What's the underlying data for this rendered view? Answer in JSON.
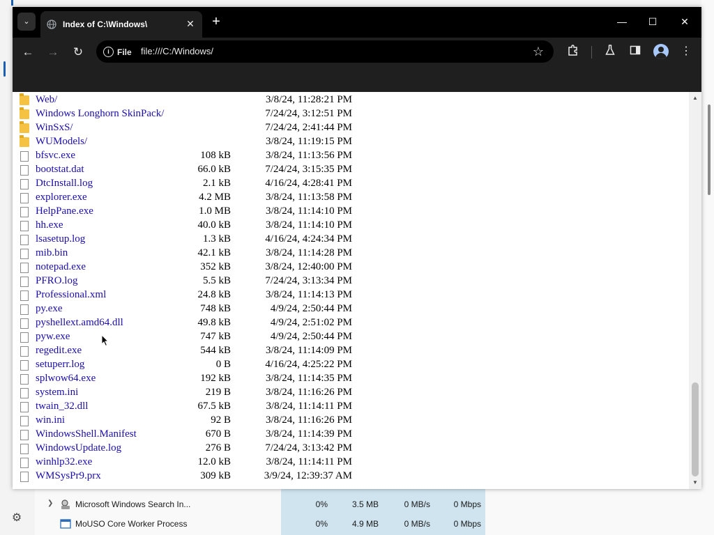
{
  "window": {
    "tab_title": "Index of C:\\Windows\\",
    "url": "file:///C:/Windows/",
    "url_chip_label": "File",
    "theme": {
      "frame": "#000000",
      "toolbar": "#1f1f1f",
      "link": "#1a0dab",
      "folder": "#f5c242"
    }
  },
  "icons": {
    "tab_search": "chevron-down-icon",
    "tab_favicon": "globe-icon",
    "tab_close": "close-icon",
    "new_tab": "plus-icon",
    "minimize": "minimize-icon",
    "maximize": "maximize-icon",
    "close_window": "close-icon",
    "back": "back-arrow-icon",
    "forward": "forward-arrow-icon",
    "reload": "reload-icon",
    "site_info": "info-icon",
    "bookmark": "star-icon",
    "extensions": "puzzle-icon",
    "labs": "flask-icon",
    "side_panel": "side-panel-icon",
    "profile": "avatar-icon",
    "menu": "kebab-menu-icon"
  },
  "listing": [
    {
      "name": "Web/",
      "size": "",
      "date": "3/8/24, 11:28:21 PM",
      "type": "folder"
    },
    {
      "name": "Windows Longhorn SkinPack/",
      "size": "",
      "date": "7/24/24, 3:12:51 PM",
      "type": "folder"
    },
    {
      "name": "WinSxS/",
      "size": "",
      "date": "7/24/24, 2:41:44 PM",
      "type": "folder"
    },
    {
      "name": "WUModels/",
      "size": "",
      "date": "3/8/24, 11:19:15 PM",
      "type": "folder"
    },
    {
      "name": "bfsvc.exe",
      "size": "108 kB",
      "date": "3/8/24, 11:13:56 PM",
      "type": "file"
    },
    {
      "name": "bootstat.dat",
      "size": "66.0 kB",
      "date": "7/24/24, 3:15:35 PM",
      "type": "file"
    },
    {
      "name": "DtcInstall.log",
      "size": "2.1 kB",
      "date": "4/16/24, 4:28:41 PM",
      "type": "file"
    },
    {
      "name": "explorer.exe",
      "size": "4.2 MB",
      "date": "3/8/24, 11:13:58 PM",
      "type": "file"
    },
    {
      "name": "HelpPane.exe",
      "size": "1.0 MB",
      "date": "3/8/24, 11:14:10 PM",
      "type": "file"
    },
    {
      "name": "hh.exe",
      "size": "40.0 kB",
      "date": "3/8/24, 11:14:10 PM",
      "type": "file"
    },
    {
      "name": "lsasetup.log",
      "size": "1.3 kB",
      "date": "4/16/24, 4:24:34 PM",
      "type": "file"
    },
    {
      "name": "mib.bin",
      "size": "42.1 kB",
      "date": "3/8/24, 11:14:28 PM",
      "type": "file"
    },
    {
      "name": "notepad.exe",
      "size": "352 kB",
      "date": "3/8/24, 12:40:00 PM",
      "type": "file"
    },
    {
      "name": "PFRO.log",
      "size": "5.5 kB",
      "date": "7/24/24, 3:13:34 PM",
      "type": "file"
    },
    {
      "name": "Professional.xml",
      "size": "24.8 kB",
      "date": "3/8/24, 11:14:13 PM",
      "type": "file"
    },
    {
      "name": "py.exe",
      "size": "748 kB",
      "date": "4/9/24, 2:50:44 PM",
      "type": "file"
    },
    {
      "name": "pyshellext.amd64.dll",
      "size": "49.8 kB",
      "date": "4/9/24, 2:51:02 PM",
      "type": "file"
    },
    {
      "name": "pyw.exe",
      "size": "747 kB",
      "date": "4/9/24, 2:50:44 PM",
      "type": "file"
    },
    {
      "name": "regedit.exe",
      "size": "544 kB",
      "date": "3/8/24, 11:14:09 PM",
      "type": "file"
    },
    {
      "name": "setuperr.log",
      "size": "0 B",
      "date": "4/16/24, 4:25:22 PM",
      "type": "file"
    },
    {
      "name": "splwow64.exe",
      "size": "192 kB",
      "date": "3/8/24, 11:14:35 PM",
      "type": "file"
    },
    {
      "name": "system.ini",
      "size": "219 B",
      "date": "3/8/24, 11:16:26 PM",
      "type": "file"
    },
    {
      "name": "twain_32.dll",
      "size": "67.5 kB",
      "date": "3/8/24, 11:14:11 PM",
      "type": "file"
    },
    {
      "name": "win.ini",
      "size": "92 B",
      "date": "3/8/24, 11:16:26 PM",
      "type": "file"
    },
    {
      "name": "WindowsShell.Manifest",
      "size": "670 B",
      "date": "3/8/24, 11:14:39 PM",
      "type": "file"
    },
    {
      "name": "WindowsUpdate.log",
      "size": "276 B",
      "date": "7/24/24, 3:13:42 PM",
      "type": "file"
    },
    {
      "name": "winhlp32.exe",
      "size": "12.0 kB",
      "date": "3/8/24, 11:14:11 PM",
      "type": "file"
    },
    {
      "name": "WMSysPr9.prx",
      "size": "309 kB",
      "date": "3/9/24, 12:39:37 AM",
      "type": "file"
    }
  ],
  "task_manager": {
    "rows": [
      {
        "name": "Microsoft Windows Search In...",
        "cpu": "0%",
        "memory": "3.5 MB",
        "disk": "0 MB/s",
        "network": "0 Mbps",
        "expandable": true
      },
      {
        "name": "MoUSO Core Worker Process",
        "cpu": "0%",
        "memory": "4.9 MB",
        "disk": "0 MB/s",
        "network": "0 Mbps",
        "expandable": false
      }
    ],
    "heat_color": "#cfe4ef"
  }
}
